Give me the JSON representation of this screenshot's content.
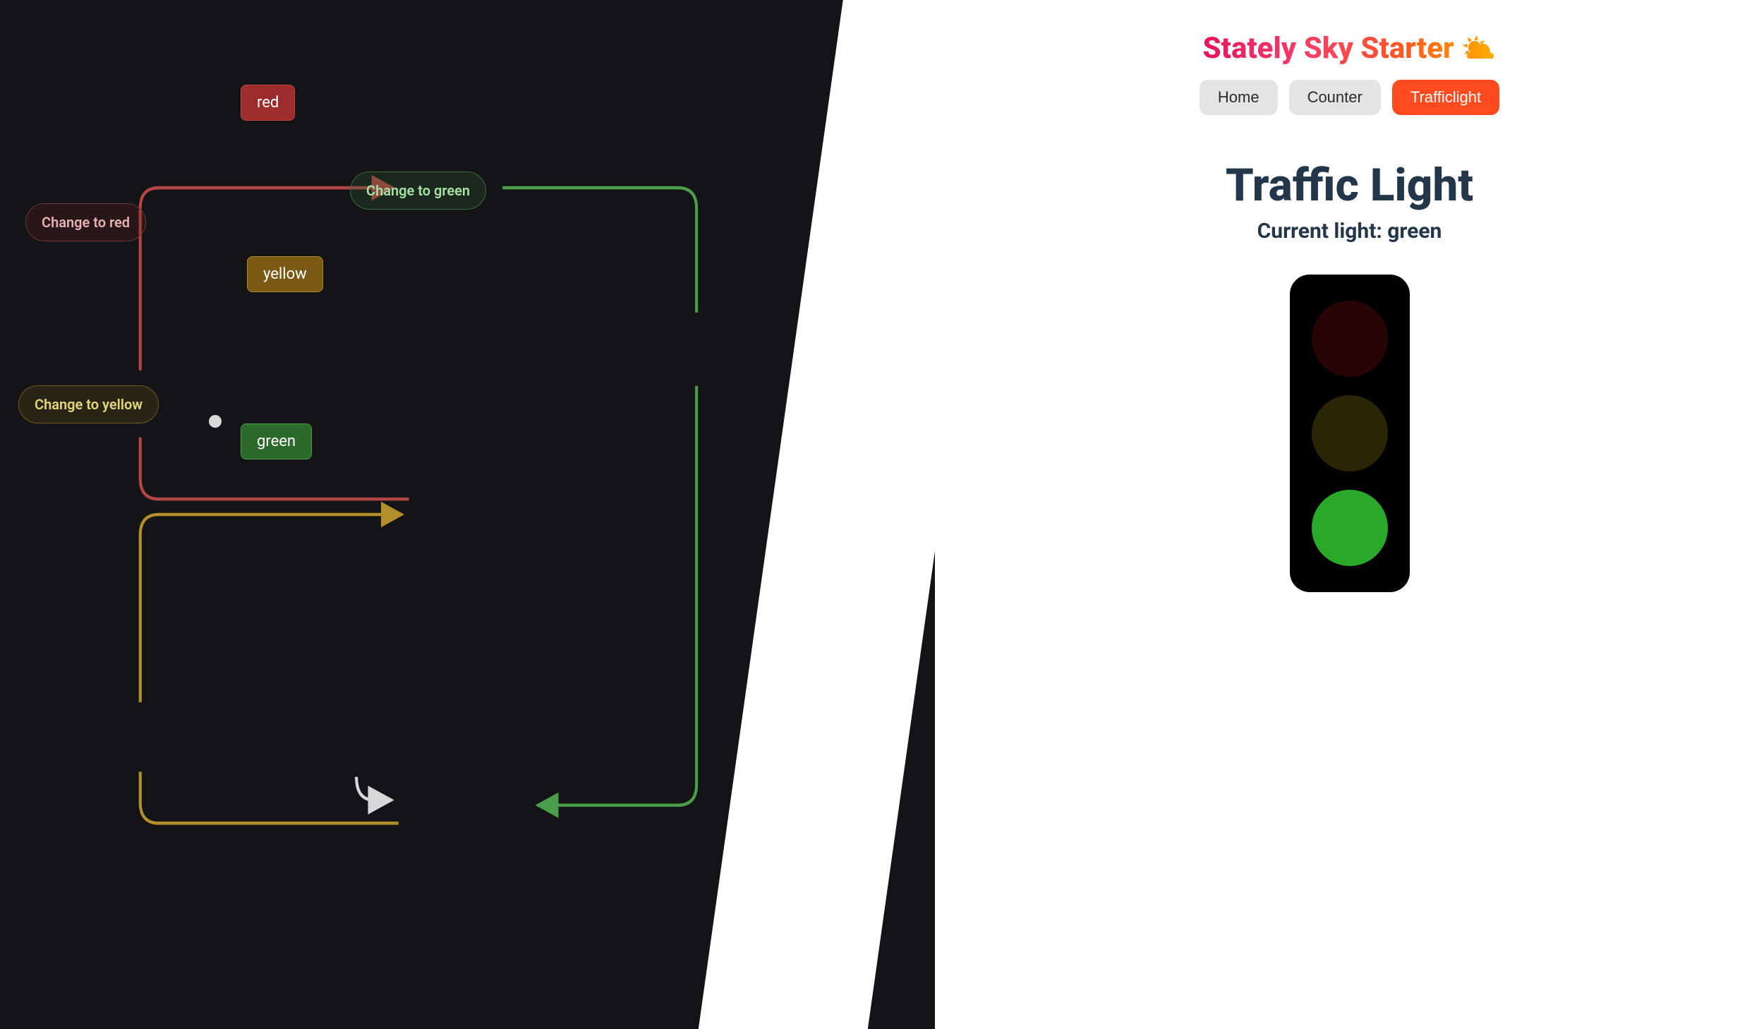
{
  "diagram": {
    "states": {
      "red": {
        "label": "red"
      },
      "yellow": {
        "label": "yellow"
      },
      "green": {
        "label": "green"
      }
    },
    "transitions": {
      "to_green": {
        "label": "Change to green"
      },
      "to_red": {
        "label": "Change to red"
      },
      "to_yellow": {
        "label": "Change to yellow"
      }
    },
    "colors": {
      "red_stroke": "#b24545",
      "yellow_stroke": "#b28f2a",
      "green_stroke": "#4a9d4a"
    }
  },
  "app": {
    "title": "Stately Sky Starter",
    "icon": "⛅",
    "nav": [
      {
        "label": "Home",
        "active": false
      },
      {
        "label": "Counter",
        "active": false
      },
      {
        "label": "Trafficlight",
        "active": true
      }
    ],
    "page_heading": "Traffic Light",
    "subheading": "Current light: green",
    "current_light": "green"
  }
}
